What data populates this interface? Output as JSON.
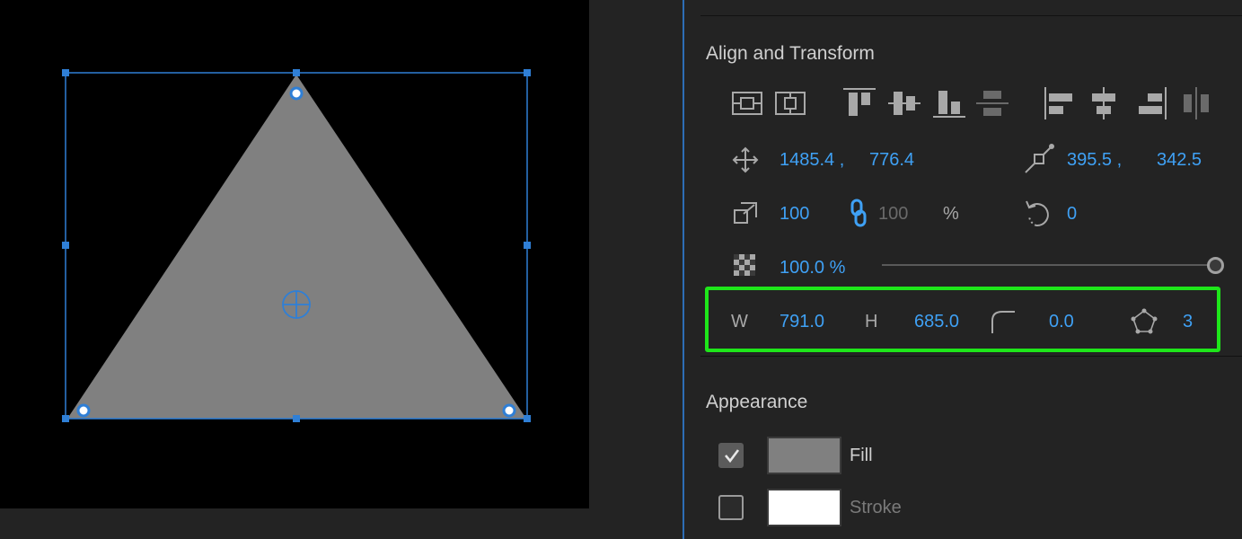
{
  "align_transform": {
    "title": "Align and Transform",
    "position": {
      "x": "1485.4 ,",
      "y": "776.4"
    },
    "anchor": {
      "x": "395.5 ,",
      "y": "342.5"
    },
    "scale": {
      "value": "100",
      "linked_value": "100",
      "unit": "%"
    },
    "rotation": "0",
    "opacity": {
      "value": "100.0 %",
      "level": 1.0
    },
    "shape": {
      "width_label": "W",
      "width": "791.0",
      "height_label": "H",
      "height": "685.0",
      "corner_radius": "0.0",
      "sides": "3"
    }
  },
  "appearance": {
    "title": "Appearance",
    "fill": {
      "label": "Fill",
      "checked": true,
      "color": "#808080"
    },
    "stroke": {
      "label": "Stroke",
      "checked": false,
      "color": "#ffffff"
    }
  },
  "colors": {
    "accent": "#3fa1f5",
    "highlight": "#1ee61a",
    "selection": "#2f7fd6",
    "shape_fill": "#808080"
  },
  "icons": [
    "align-selection-icon",
    "align-keyframe-icon",
    "align-top-icon",
    "align-vcenter-icon",
    "align-bottom-icon",
    "distribute-vertical-icon",
    "align-left-icon",
    "align-hcenter-icon",
    "align-right-icon",
    "distribute-horizontal-icon",
    "move-icon",
    "anchor-point-icon",
    "scale-icon",
    "link-icon",
    "rotation-icon",
    "opacity-icon",
    "corner-radius-icon",
    "polygon-icon",
    "checkmark-icon"
  ]
}
